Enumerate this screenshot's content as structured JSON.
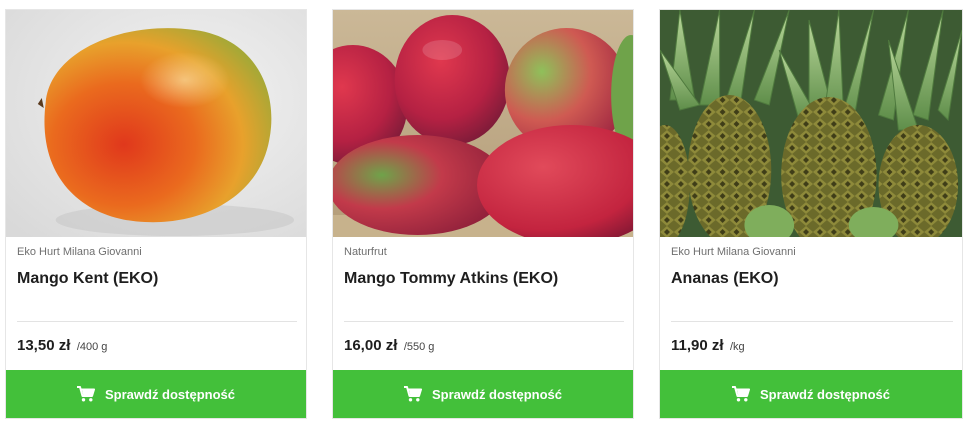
{
  "products": [
    {
      "seller": "Eko Hurt Milana Giovanni",
      "name": "Mango Kent (EKO)",
      "price": "13,50 zł",
      "unit": "/400 g",
      "button_label": "Sprawdź dostępność",
      "image": "mango-kent-photo"
    },
    {
      "seller": "Naturfrut",
      "name": "Mango Tommy Atkins (EKO)",
      "price": "16,00 zł",
      "unit": "/550 g",
      "button_label": "Sprawdź dostępność",
      "image": "mango-tommy-atkins-photo"
    },
    {
      "seller": "Eko Hurt Milana Giovanni",
      "name": "Ananas (EKO)",
      "price": "11,90 zł",
      "unit": "/kg",
      "button_label": "Sprawdź dostępność",
      "image": "pineapple-photo"
    }
  ],
  "colors": {
    "button": "#43c03a",
    "button_text": "#ffffff",
    "seller_text": "#6f6f6f"
  },
  "icons": {
    "cart": "cart-icon"
  }
}
